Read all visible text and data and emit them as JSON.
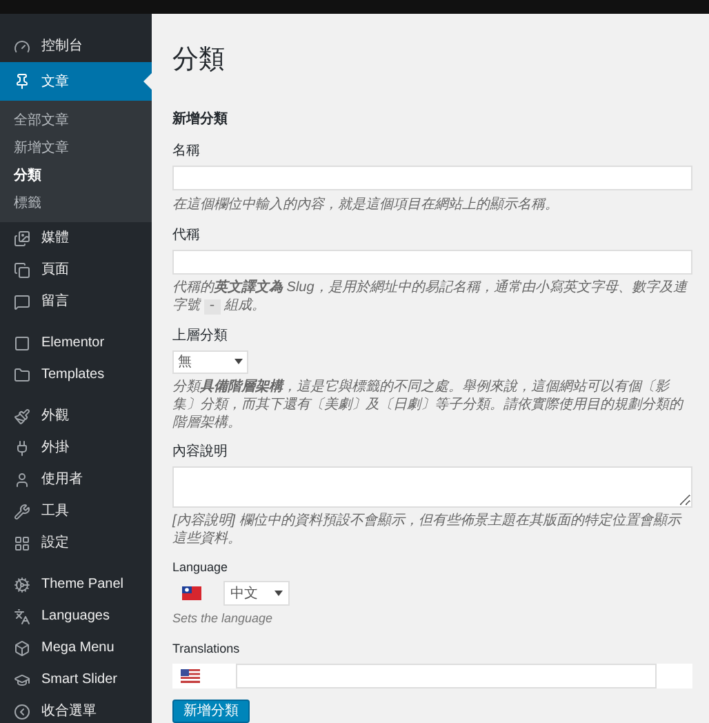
{
  "sidebar": {
    "sections": [
      [
        {
          "label": "控制台",
          "selected": false
        },
        {
          "label": "文章",
          "selected": true,
          "children": [
            {
              "label": "全部文章",
              "selected": false
            },
            {
              "label": "新增文章",
              "selected": false
            },
            {
              "label": "分類",
              "selected": true
            },
            {
              "label": "標籤",
              "selected": false
            }
          ]
        },
        {
          "label": "媒體",
          "selected": false
        },
        {
          "label": "頁面",
          "selected": false
        },
        {
          "label": "留言",
          "selected": false
        }
      ],
      [
        {
          "label": "Elementor",
          "selected": false
        },
        {
          "label": "Templates",
          "selected": false
        }
      ],
      [
        {
          "label": "外觀",
          "selected": false
        },
        {
          "label": "外掛",
          "selected": false
        },
        {
          "label": "使用者",
          "selected": false
        },
        {
          "label": "工具",
          "selected": false
        },
        {
          "label": "設定",
          "selected": false
        }
      ],
      [
        {
          "label": "Theme Panel",
          "selected": false
        },
        {
          "label": "Languages",
          "selected": false
        },
        {
          "label": "Mega Menu",
          "selected": false
        },
        {
          "label": "Smart Slider",
          "selected": false
        },
        {
          "label": "收合選單",
          "selected": false
        }
      ]
    ]
  },
  "page_title": "分類",
  "form": {
    "heading": "新增分類",
    "name": {
      "label": "名稱",
      "hint": "在這個欄位中輸入的內容，就是這個項目在網站上的顯示名稱。"
    },
    "slug": {
      "label": "代稱",
      "hint_before": "代稱的**英文譯文為** Slug，是用於網址中的易記名稱，通常由小寫英文字母、數字及連字號",
      "hint_code": "-",
      "hint_after": "組成。"
    },
    "parent": {
      "label": "上層分類",
      "value": "無",
      "hint": "分類**具備階層架構**，這是它與標籤的不同之處。舉例來說，這個網站可以有個〔影集〕分類，而其下還有〔美劇〕及〔日劇〕等子分類。請依實際使用目的規劃分類的階層架構。"
    },
    "description": {
      "label": "內容說明",
      "hint": "[內容說明] 欄位中的資料預設不會顯示，但有些佈景主題在其版面的特定位置會顯示這些資料。"
    },
    "language": {
      "label": "Language",
      "value": "中文",
      "hint": "Sets the language"
    },
    "translations": {
      "label": "Translations"
    },
    "submit": "新增分類"
  }
}
